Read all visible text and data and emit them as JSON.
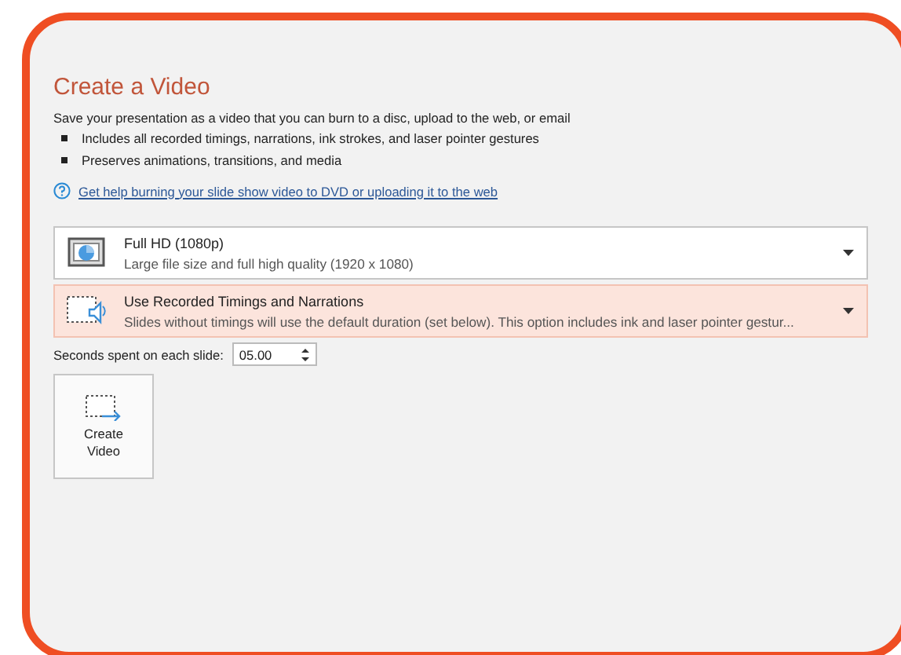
{
  "title": "Create a Video",
  "description": "Save your presentation as a video that you can burn to a disc, upload to the web, or email",
  "bullets": [
    "Includes all recorded timings, narrations, ink strokes, and laser pointer gestures",
    "Preserves animations, transitions, and media"
  ],
  "help_link": "Get help burning your slide show video to DVD or uploading it to the web",
  "dropdowns": [
    {
      "kind": "quality",
      "title": "Full HD (1080p)",
      "subtitle": "Large file size and full high quality (1920 x 1080)",
      "highlighted": false
    },
    {
      "kind": "timings",
      "title": "Use Recorded Timings and Narrations",
      "subtitle": "Slides without timings will use the default duration (set below). This option includes ink and laser pointer gestur...",
      "highlighted": true
    }
  ],
  "seconds": {
    "label": "Seconds spent on each slide:",
    "value": "05.00"
  },
  "create_button": {
    "label": "Create\nVideo"
  }
}
